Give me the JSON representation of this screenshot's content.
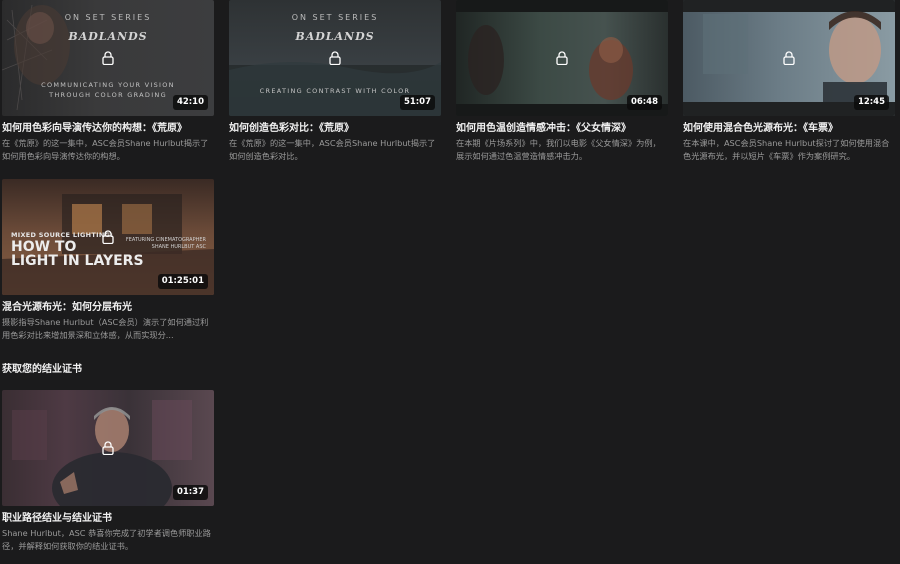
{
  "colors": {
    "background": "#1b1b1c",
    "title": "#f1f1f1",
    "description": "#9a9a9a",
    "badge_bg": "#0c0c0c"
  },
  "videos": [
    {
      "title": "如何用色彩向导演传达你的构想：《荒原》",
      "description": "在《荒原》的这一集中，ASC会员Shane Hurlbut揭示了如何用色彩向导演传达你的构想。",
      "duration": "42:10",
      "overlay": {
        "series": "ON SET SERIES",
        "logo": "BADLANDS",
        "subtitle": "COMMUNICATING YOUR VISION THROUGH COLOR GRADING"
      },
      "icon": "lock-icon"
    },
    {
      "title": "如何创造色彩对比：《荒原》",
      "description": "在《荒原》的这一集中，ASC会员Shane Hurlbut揭示了如何创造色彩对比。",
      "duration": "51:07",
      "overlay": {
        "series": "ON SET SERIES",
        "logo": "BADLANDS",
        "subtitle": "CREATING CONTRAST WITH COLOR"
      },
      "icon": "lock-icon"
    },
    {
      "title": "如何用色温创造情感冲击：《父女情深》",
      "description": "在本期《片场系列》中，我们以电影《父女情深》为例，展示如何通过色温营造情感冲击力。",
      "duration": "06:48",
      "icon": "lock-icon"
    },
    {
      "title": "如何使用混合色光源布光：《车票》",
      "description": "在本课中，ASC会员Shane Hurlbut探讨了如何使用混合色光源布光，并以短片《车票》作为案例研究。",
      "duration": "12:45",
      "icon": "lock-icon"
    },
    {
      "title": "混合光源布光：如何分层布光",
      "description": "摄影指导Shane Hurlbut（ASC会员）演示了如何通过利用色彩对比来增加景深和立体感，从而实现分...",
      "duration": "01:25:01",
      "overlay": {
        "small": "MIXED SOURCE LIGHTING:",
        "big_line1": "HOW TO",
        "big_line2": "LIGHT IN LAYERS",
        "tag_line1": "FEATURING CINEMATOGRAPHER",
        "tag_line2": "SHANE HURLBUT ASC"
      },
      "icon": "lock-icon"
    }
  ],
  "certificate_section": {
    "heading": "获取您的结业证书",
    "video": {
      "title": "职业路径结业与结业证书",
      "description": "Shane Hurlbut，ASC 恭喜你完成了初学者调色师职业路径，并解释如何获取你的结业证书。",
      "duration": "01:37",
      "icon": "lock-icon"
    }
  }
}
